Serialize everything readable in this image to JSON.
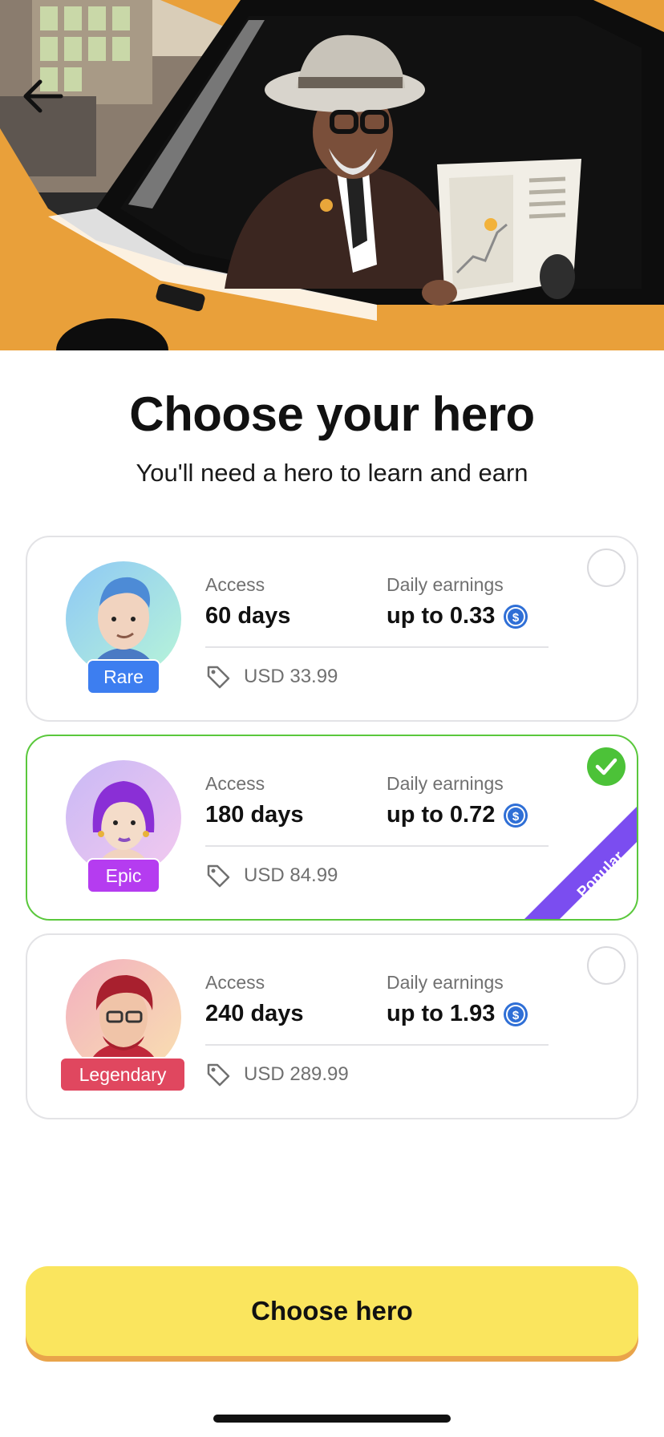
{
  "header": {
    "title": "Choose your hero",
    "subtitle": "You'll need a hero to learn and earn"
  },
  "icons": {
    "back": "arrow-left-icon",
    "coin": "usd-coin-icon",
    "price": "price-tag-icon",
    "check": "check-icon"
  },
  "plans": [
    {
      "tier": "Rare",
      "tier_color": "#3d7ef0",
      "access_label": "Access",
      "access_value": "60 days",
      "earnings_label": "Daily earnings",
      "earnings_value": "up to 0.33",
      "price": "USD 33.99",
      "selected": false
    },
    {
      "tier": "Epic",
      "tier_color": "#b53cf0",
      "access_label": "Access",
      "access_value": "180 days",
      "earnings_label": "Daily earnings",
      "earnings_value": "up to 0.72",
      "price": "USD 84.99",
      "selected": true,
      "ribbon": "Popular",
      "ribbon_color": "#7b4df0"
    },
    {
      "tier": "Legendary",
      "tier_color": "#e0475f",
      "access_label": "Access",
      "access_value": "240 days",
      "earnings_label": "Daily earnings",
      "earnings_value": "up to 1.93",
      "price": "USD 289.99",
      "selected": false
    }
  ],
  "cta": {
    "label": "Choose hero",
    "color": "#fae55e"
  }
}
